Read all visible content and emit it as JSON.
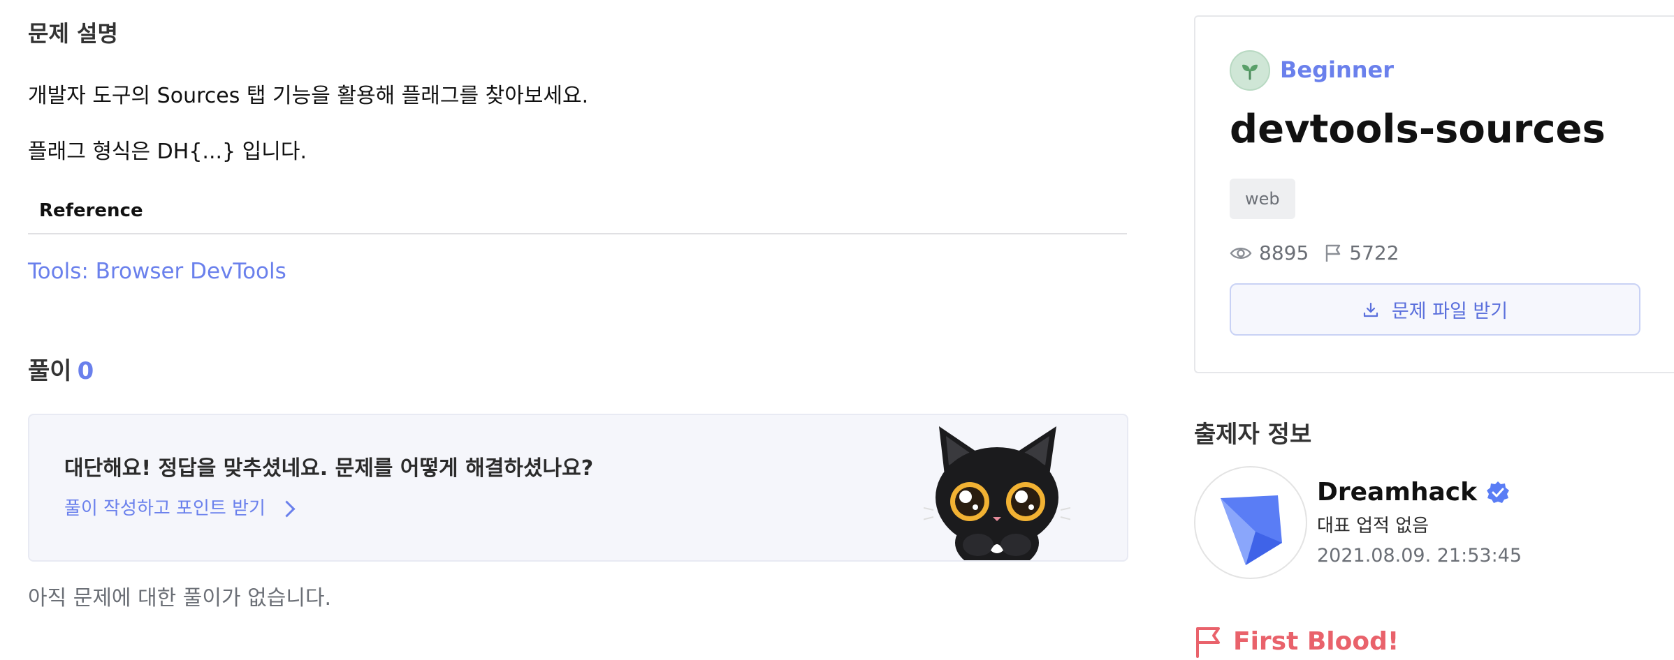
{
  "description": {
    "title": "문제 설명",
    "line1": "개발자 도구의 Sources 탭 기능을 활용해 플래그를 찾아보세요.",
    "line2": "플래그 형식은 DH{...} 입니다.",
    "reference_heading": "Reference",
    "reference_link": "Tools: Browser DevTools"
  },
  "solutions": {
    "title": "풀이",
    "count": "0",
    "prompt_question": "대단해요! 정답을 맞추셨네요. 문제를 어떻게 해결하셨나요?",
    "prompt_link": "풀이 작성하고 포인트 받기",
    "empty_text": "아직 문제에 대한 풀이가 없습니다."
  },
  "challenge": {
    "level": "Beginner",
    "title": "devtools-sources",
    "tag": "web",
    "views": "8895",
    "solves": "5722",
    "download_label": "문제 파일 받기"
  },
  "author": {
    "section_title": "출제자 정보",
    "name": "Dreamhack",
    "achievement": "대표 업적 없음",
    "date": "2021.08.09. 21:53:45"
  },
  "first_blood": {
    "label": "First Blood!"
  },
  "colors": {
    "accent": "#6a80ec",
    "first_blood": "#e9626b"
  },
  "icons": {
    "level": "sprout-icon",
    "views": "eye-icon",
    "solves": "flag-outline-icon",
    "download": "download-icon",
    "verified": "verified-badge-icon",
    "first_blood": "flag-icon",
    "chevron": "chevron-right-icon"
  }
}
